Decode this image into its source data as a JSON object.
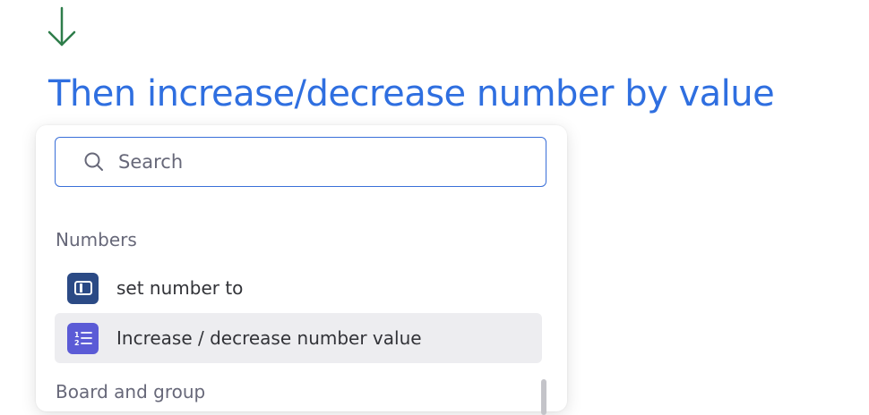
{
  "heading": "Then increase/decrease number by value",
  "search": {
    "placeholder": "Search",
    "value": ""
  },
  "sections": [
    {
      "label": "Numbers",
      "items": [
        {
          "label": "set number to",
          "icon": "number-column-icon",
          "color": "#2b4a85"
        },
        {
          "label": "Increase / decrease number value",
          "icon": "numbered-list-icon",
          "color": "#5b5bd6",
          "selected": true
        }
      ]
    },
    {
      "label": "Board and group",
      "items": []
    }
  ],
  "colors": {
    "accent": "#2f6fe0",
    "arrow": "#2e7d4a",
    "selected_bg": "#ededf0"
  }
}
